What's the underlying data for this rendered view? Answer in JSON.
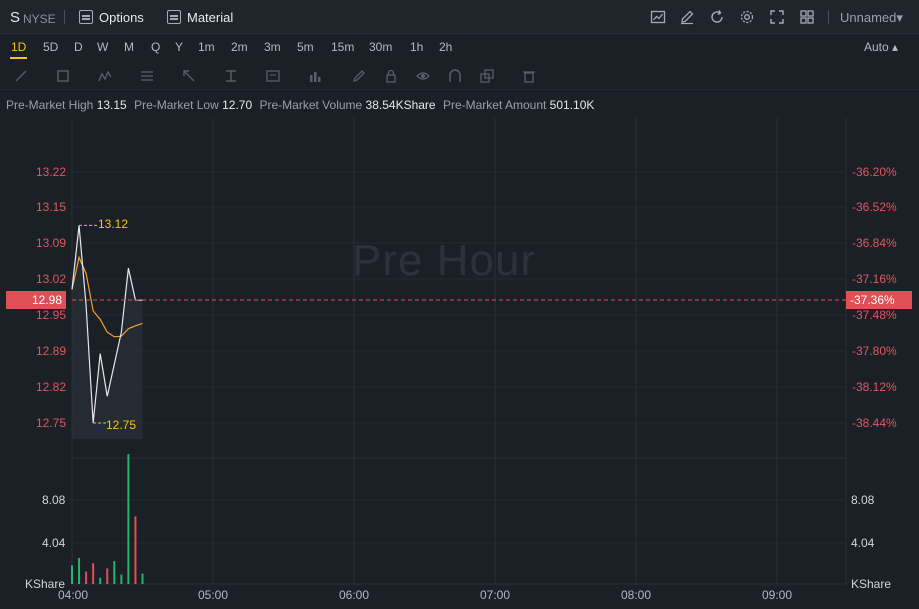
{
  "header": {
    "symbol": "S",
    "exchange": "NYSE",
    "options_label": "Options",
    "material_label": "Material",
    "layout_name": "Unnamed▾",
    "icons": [
      "chart-settings-icon",
      "edit-icon",
      "refresh-icon",
      "gear-icon",
      "fullscreen-icon",
      "grid-layout-icon"
    ]
  },
  "periods": [
    "1D",
    "5D",
    "D",
    "W",
    "M",
    "Q",
    "Y",
    "1m",
    "2m",
    "3m",
    "5m",
    "15m",
    "30m",
    "1h",
    "2h"
  ],
  "active_period": "1D",
  "scale_mode": "Auto ▴",
  "premarket": {
    "high_label": "Pre-Market High",
    "high": "13.15",
    "low_label": "Pre-Market Low",
    "low": "12.70",
    "volume_label": "Pre-Market Volume",
    "volume": "38.54KShare",
    "amount_label": "Pre-Market Amount",
    "amount": "501.10K"
  },
  "chart": {
    "watermark": "Pre Hour",
    "price_ticks": [
      "13.22",
      "13.15",
      "13.09",
      "13.02",
      "12.95",
      "12.89",
      "12.82",
      "12.75"
    ],
    "pct_ticks": [
      "-36.20%",
      "-36.52%",
      "-36.84%",
      "-37.16%",
      "-37.48%",
      "-37.80%",
      "-38.12%",
      "-38.44%"
    ],
    "current_price": "12.98",
    "current_pct": "-37.36%",
    "high_marker": "13.12",
    "low_marker": "12.75",
    "volume_ticks": [
      "8.08",
      "4.04"
    ],
    "volume_unit": "KShare",
    "time_ticks": [
      "04:00",
      "05:00",
      "06:00",
      "07:00",
      "08:00",
      "09:00"
    ],
    "colors": {
      "up": "#26b36b",
      "down": "#e04f55",
      "price_line": "#e6e8ec",
      "avg_line": "#f0a030",
      "accent": "#f5c518"
    }
  },
  "chart_data": {
    "type": "line",
    "x": [
      "04:00",
      "04:03",
      "04:06",
      "04:09",
      "04:12",
      "04:15",
      "04:18",
      "04:21",
      "04:24",
      "04:27",
      "04:30"
    ],
    "series": [
      {
        "values": [
          13.0,
          13.12,
          12.97,
          12.75,
          12.88,
          12.8,
          12.86,
          12.92,
          13.04,
          12.98,
          12.98
        ]
      }
    ],
    "volume": [
      1.8,
      2.5,
      1.2,
      2.0,
      0.6,
      1.5,
      2.2,
      0.9,
      12.5,
      6.5,
      1.0
    ],
    "ylim": [
      12.72,
      13.25
    ],
    "xlim": [
      "04:00",
      "09:30"
    ]
  }
}
